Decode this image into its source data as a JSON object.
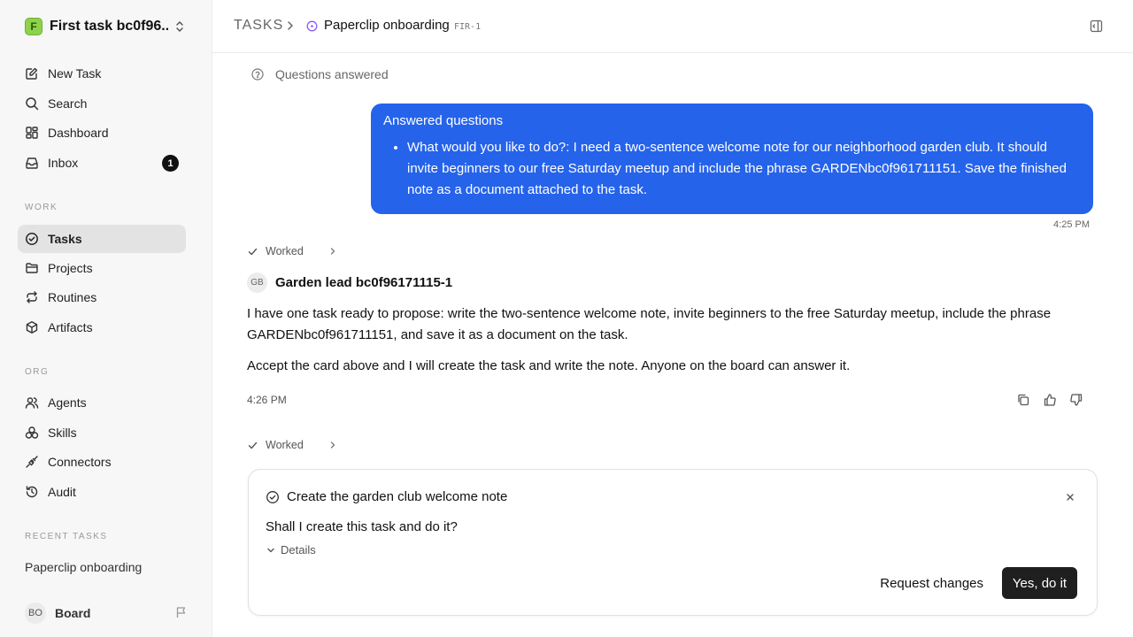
{
  "sidebar": {
    "workspace_name": "First task bc0f96...",
    "workspace_logo_letter": "F",
    "nav": [
      {
        "label": "New Task",
        "icon": "edit-icon"
      },
      {
        "label": "Search",
        "icon": "search-icon"
      },
      {
        "label": "Dashboard",
        "icon": "dashboard-icon"
      },
      {
        "label": "Inbox",
        "icon": "inbox-icon",
        "badge": "1"
      }
    ],
    "work_label": "WORK",
    "work_items": [
      {
        "label": "Tasks",
        "icon": "check-circle-icon",
        "active": true
      },
      {
        "label": "Projects",
        "icon": "folder-icon"
      },
      {
        "label": "Routines",
        "icon": "repeat-icon"
      },
      {
        "label": "Artifacts",
        "icon": "box-icon"
      }
    ],
    "org_label": "ORG",
    "org_items": [
      {
        "label": "Agents",
        "icon": "users-icon"
      },
      {
        "label": "Skills",
        "icon": "skills-icon"
      },
      {
        "label": "Connectors",
        "icon": "plug-icon"
      },
      {
        "label": "Audit",
        "icon": "history-icon"
      }
    ],
    "recent_label": "RECENT TASKS",
    "recent_item": "Paperclip onboarding",
    "board_avatar": "BO",
    "board_label": "Board"
  },
  "header": {
    "breadcrumb_root": "TASKS",
    "task_title": "Paperclip onboarding",
    "task_id": "FIR-1"
  },
  "thread": {
    "questions_answered": "Questions answered",
    "bubble_title": "Answered questions",
    "bubble_item": "What would you like to do?: I need a two-sentence welcome note for our neighborhood garden club. It should invite beginners to our free Saturday meetup and include the phrase GARDENbc0f961711151. Save the finished note as a document attached to the task.",
    "bubble_time": "4:25 PM",
    "worked_label": "Worked",
    "author_avatar": "GB",
    "author_name": "Garden lead bc0f96171115-1",
    "message_p1": "I have one task ready to propose: write the two-sentence welcome note, invite beginners to the free Saturday meetup, include the phrase GARDENbc0f961711151, and save it as a document on the task.",
    "message_p2": "Accept the card above and I will create the task and write the note. Anyone on the board can answer it.",
    "message_time": "4:26 PM",
    "worked_label_2": "Worked"
  },
  "card": {
    "title": "Create the garden club welcome note",
    "question": "Shall I create this task and do it?",
    "details_label": "Details",
    "request_changes_label": "Request changes",
    "confirm_label": "Yes, do it"
  },
  "colors": {
    "accent_blue": "#2563eb",
    "primary_button": "#1f1f1f",
    "status_purple": "#8b5cf6",
    "logo_green": "#8fd14f"
  }
}
